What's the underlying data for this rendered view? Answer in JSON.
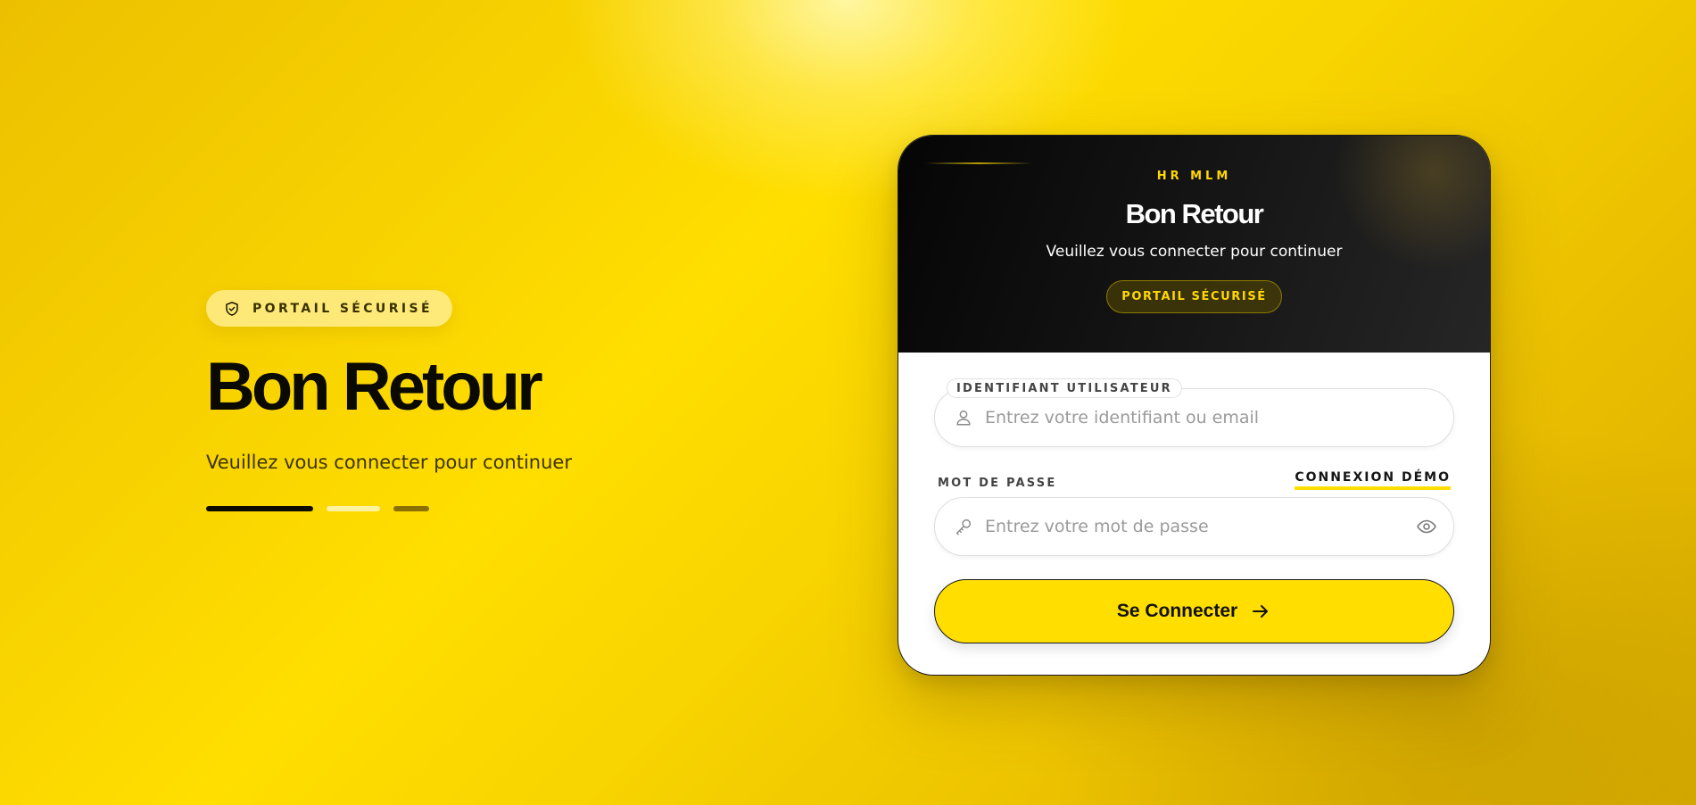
{
  "hero": {
    "badge_icon": "shield-check-icon",
    "badge_label": "PORTAIL SÉCURISÉ",
    "title": "Bon Retour",
    "subtitle": "Veuillez vous connecter pour continuer",
    "progress_steps": 3,
    "progress_active": 1
  },
  "card": {
    "brand": "HR MLM",
    "title": "Bon Retour",
    "subtitle": "Veuillez vous connecter pour continuer",
    "badge_label": "PORTAIL SÉCURISÉ",
    "username": {
      "label": "IDENTIFIANT UTILISATEUR",
      "placeholder": "Entrez votre identifiant ou email",
      "value": "",
      "icon": "user-icon"
    },
    "password": {
      "label": "MOT DE PASSE",
      "placeholder": "Entrez votre mot de passe",
      "value": "",
      "icon": "key-icon",
      "toggle_icon": "eye-icon"
    },
    "demo_link": "CONNEXION DÉMO",
    "submit_label": "Se Connecter",
    "submit_icon": "arrow-right-icon"
  },
  "colors": {
    "accent": "#ffde00",
    "dark": "#0b0a00",
    "header_bg": "#151515"
  }
}
